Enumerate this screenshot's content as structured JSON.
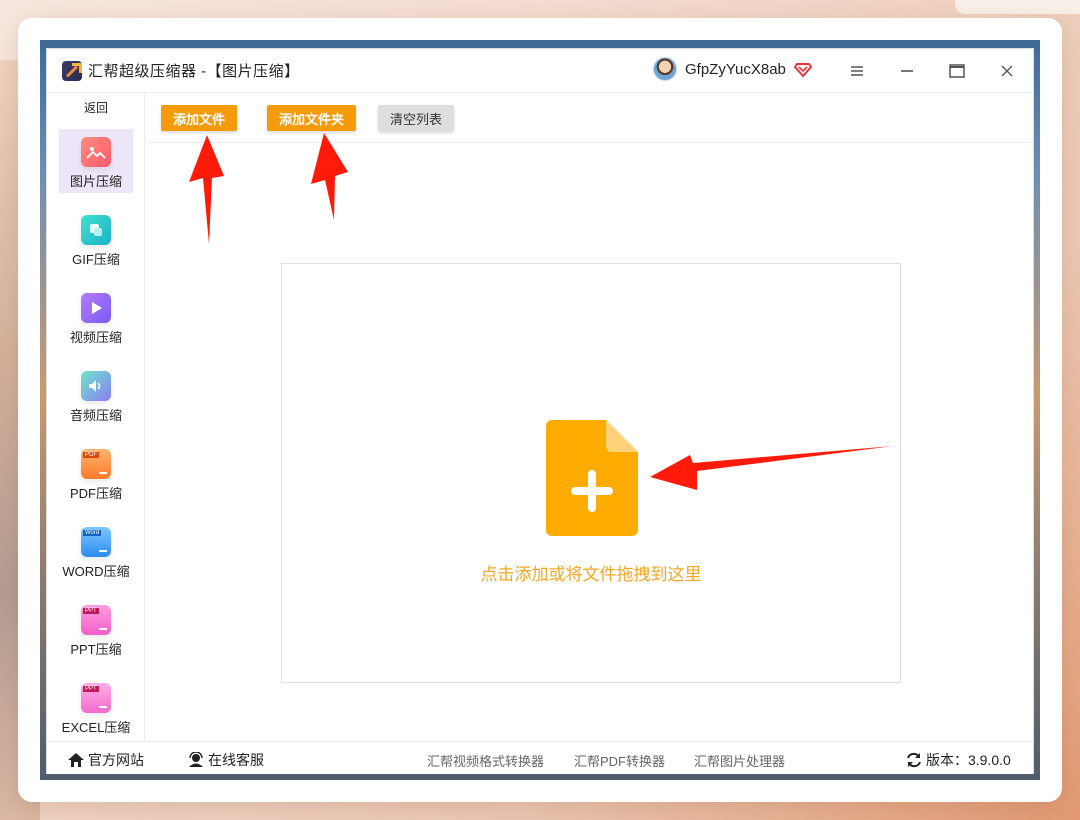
{
  "window": {
    "title": "汇帮超级压缩器  -【图片压缩】",
    "username": "GfpZyYucX8ab"
  },
  "sidebar": {
    "back_label": "返回",
    "items": [
      {
        "label": "图片压缩",
        "icon": "image-icon",
        "active": true
      },
      {
        "label": "GIF压缩",
        "icon": "gif-icon",
        "active": false
      },
      {
        "label": "视频压缩",
        "icon": "video-play-icon",
        "active": false
      },
      {
        "label": "音频压缩",
        "icon": "speaker-icon",
        "active": false
      },
      {
        "label": "PDF压缩",
        "icon": "pdf-file-icon",
        "badge": "PDF",
        "active": false
      },
      {
        "label": "WORD压缩",
        "icon": "word-file-icon",
        "badge": "Word",
        "active": false
      },
      {
        "label": "PPT压缩",
        "icon": "ppt-file-icon",
        "badge": "PPT",
        "active": false
      },
      {
        "label": "EXCEL压缩",
        "icon": "excel-file-icon",
        "badge": "PPT",
        "active": false
      }
    ]
  },
  "toolbar": {
    "add_file": "添加文件",
    "add_folder": "添加文件夹",
    "clear_list": "清空列表"
  },
  "dropzone": {
    "hint": "点击添加或将文件拖拽到这里",
    "icon": "add-file-icon"
  },
  "statusbar": {
    "website": "官方网站",
    "support": "在线客服",
    "links": [
      "汇帮视频格式转换器",
      "汇帮PDF转换器",
      "汇帮图片处理器"
    ],
    "version_label": "版本：",
    "version": "3.9.0.0"
  },
  "colors": {
    "accent": "#f59b0a",
    "hint_text": "#f5a623",
    "active_sidebar": "#ede6f9",
    "annotation_arrow": "#ff1a0a"
  }
}
